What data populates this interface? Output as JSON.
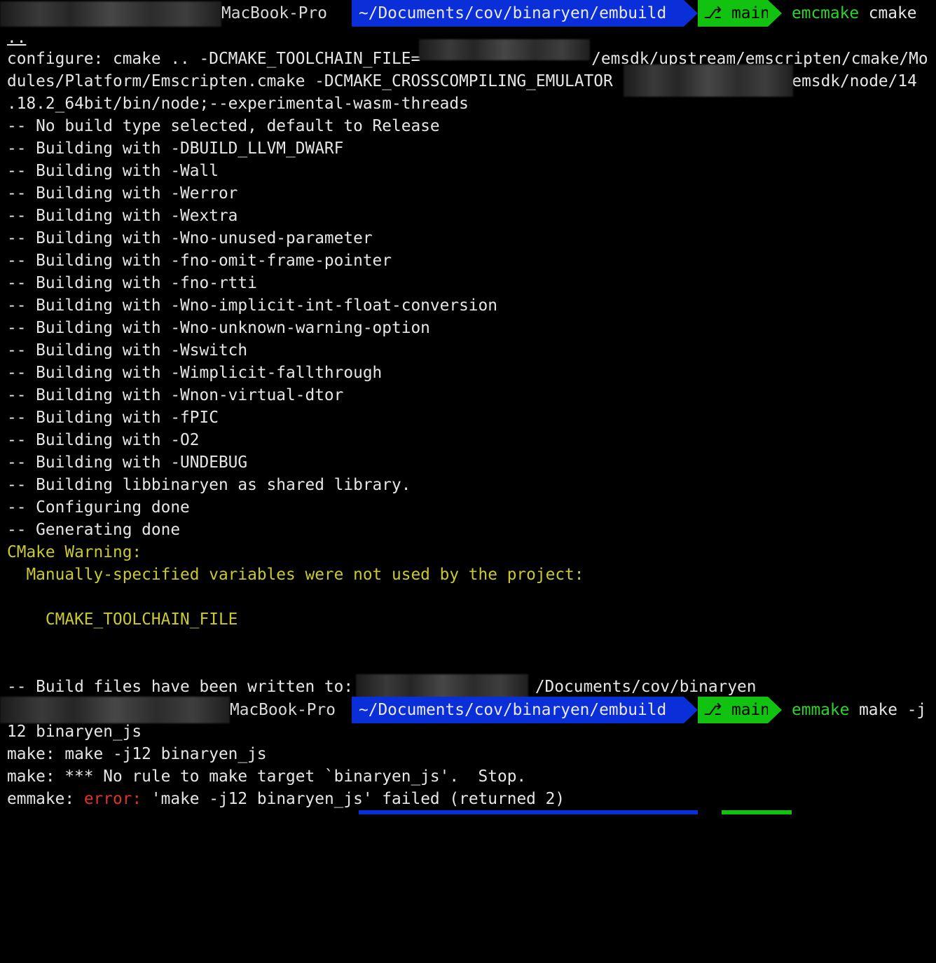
{
  "prompt1": {
    "user_host": "MacBook-Pro",
    "path": "~/Documents/cov/binaryen/embuild",
    "branch_icon": "git-branch-icon",
    "branch": "main",
    "cmd": "emcmake",
    "args": " cmake"
  },
  "output1": [
    "..",
    "configure: cmake .. -DCMAKE_TOOLCHAIN_FILE=",
    "/emsdk/upstream/emscripten/cmake/Mo",
    "dules/Platform/Emscripten.cmake -DCMAKE_CROSSCOMPILING_EMULATOR",
    "/emsdk/node/14",
    ".18.2_64bit/bin/node;--experimental-wasm-threads",
    "-- No build type selected, default to Release",
    "-- Building with -DBUILD_LLVM_DWARF",
    "-- Building with -Wall",
    "-- Building with -Werror",
    "-- Building with -Wextra",
    "-- Building with -Wno-unused-parameter",
    "-- Building with -fno-omit-frame-pointer",
    "-- Building with -fno-rtti",
    "-- Building with -Wno-implicit-int-float-conversion",
    "-- Building with -Wno-unknown-warning-option",
    "-- Building with -Wswitch",
    "-- Building with -Wimplicit-fallthrough",
    "-- Building with -Wnon-virtual-dtor",
    "-- Building with -fPIC",
    "-- Building with -O2",
    "-- Building with -UNDEBUG",
    "-- Building libbinaryen as shared library.",
    "-- Configuring done",
    "-- Generating done"
  ],
  "warning": {
    "title": "CMake Warning:",
    "message": "  Manually-specified variables were not used by the project:",
    "variable": "    CMAKE_TOOLCHAIN_FILE"
  },
  "written": {
    "prefix": "-- Build files have been written to: ",
    "suffix": "/Documents/cov/binaryen"
  },
  "prompt2": {
    "user_host": "MacBook-Pro",
    "path": "~/Documents/cov/binaryen/embuild",
    "branch": "main",
    "cmd": "emmake",
    "args": " make -j"
  },
  "output2": {
    "wrap": "12 binaryen_js",
    "l1": "make: make -j12 binaryen_js",
    "l2": "make: *** No rule to make target `binaryen_js'.  Stop.",
    "l3_prefix": "emmake: ",
    "l3_error": "error:",
    "l3_rest": " 'make -j12 binaryen_js' failed (returned 2)"
  },
  "colors": {
    "path_bg": "#0a2fd8",
    "branch_bg": "#11c310",
    "command_green": "#2fd22f",
    "warning_yellow": "#c9c930",
    "error_red": "#e2332b"
  }
}
